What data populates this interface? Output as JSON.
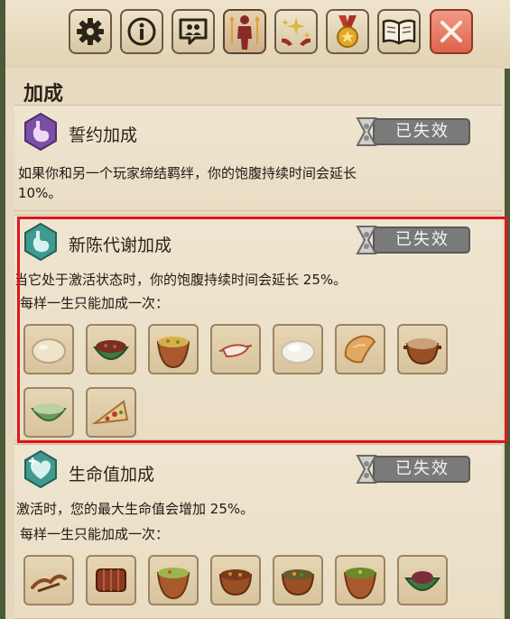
{
  "tabs": [
    {
      "icon": "gear-icon"
    },
    {
      "icon": "info-icon"
    },
    {
      "icon": "friends-bubble-icon"
    },
    {
      "icon": "character-boost-icon"
    },
    {
      "icon": "sparkle-hands-icon"
    },
    {
      "icon": "medal-icon"
    },
    {
      "icon": "book-icon"
    },
    {
      "icon": "close-icon"
    }
  ],
  "section_title": "加成",
  "bonuses": [
    {
      "name": "誓约加成",
      "status": "已失效",
      "icon": "stomach-icon",
      "desc_line1": "如果你和另一个玩家缔结羁绊，你的饱腹持续时间会延长",
      "desc_line2": "10%。"
    },
    {
      "name": "新陈代谢加成",
      "status": "已失效",
      "icon": "stomach-icon",
      "desc_line1": "当它处于激活状态时，你的饱腹持续时间会延长 25%。",
      "desc_line2": "每样一生只能加成一次：",
      "foods": [
        "egg-food-icon",
        "cabbage-bowl-food-icon",
        "pumpkin-soup-food-icon",
        "meat-skewer-food-icon",
        "rice-ball-food-icon",
        "bread-food-icon",
        "stew-pot-food-icon",
        "green-bowl-food-icon",
        "pizza-slice-food-icon"
      ]
    },
    {
      "name": "生命值加成",
      "status": "已失效",
      "icon": "heart-plus-icon",
      "desc_line1": "激活时，您的最大生命值会增加 25%。",
      "desc_line2": "每样一生只能加成一次：",
      "foods": [
        "roast-food-icon",
        "ribs-food-icon",
        "salad-pot-food-icon",
        "meat-stew-food-icon",
        "soup-pot-food-icon",
        "veggie-pot-food-icon",
        "cabbage-dish-food-icon"
      ]
    }
  ]
}
